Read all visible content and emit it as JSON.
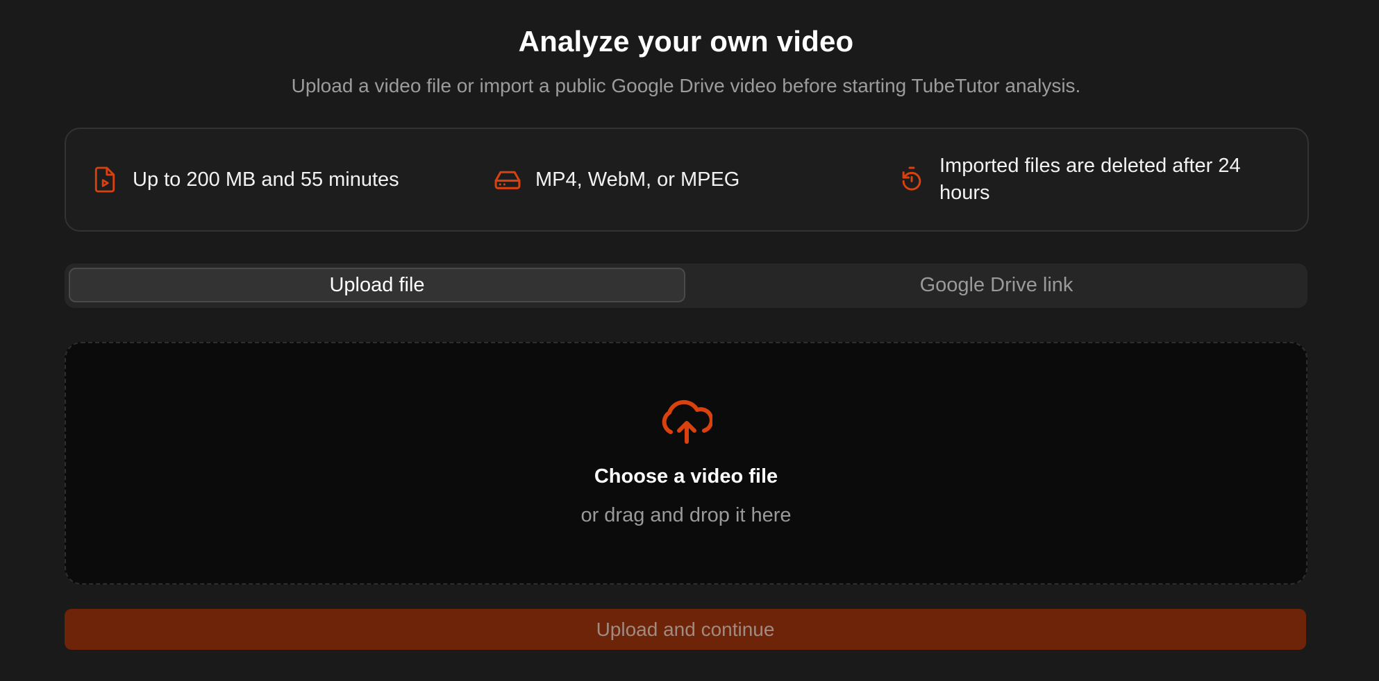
{
  "header": {
    "title": "Analyze your own video",
    "subtitle": "Upload a video file or import a public Google Drive video before starting TubeTutor analysis."
  },
  "info": {
    "items": [
      {
        "icon": "file-video-icon",
        "text": "Up to 200 MB and 55 minutes"
      },
      {
        "icon": "hard-drive-icon",
        "text": "MP4, WebM, or MPEG"
      },
      {
        "icon": "timer-reset-icon",
        "text": "Imported files are deleted after 24 hours"
      }
    ]
  },
  "tabs": {
    "upload_label": "Upload file",
    "drive_label": "Google Drive link",
    "selected": "Upload file"
  },
  "dropzone": {
    "icon": "cloud-upload-icon",
    "title": "Choose a video file",
    "subtitle": "or drag and drop it here"
  },
  "submit": {
    "label": "Upload and continue"
  },
  "colors": {
    "background": "#1a1a1a",
    "accent": "#d9410f",
    "button_disabled_bg": "#6e2408"
  }
}
